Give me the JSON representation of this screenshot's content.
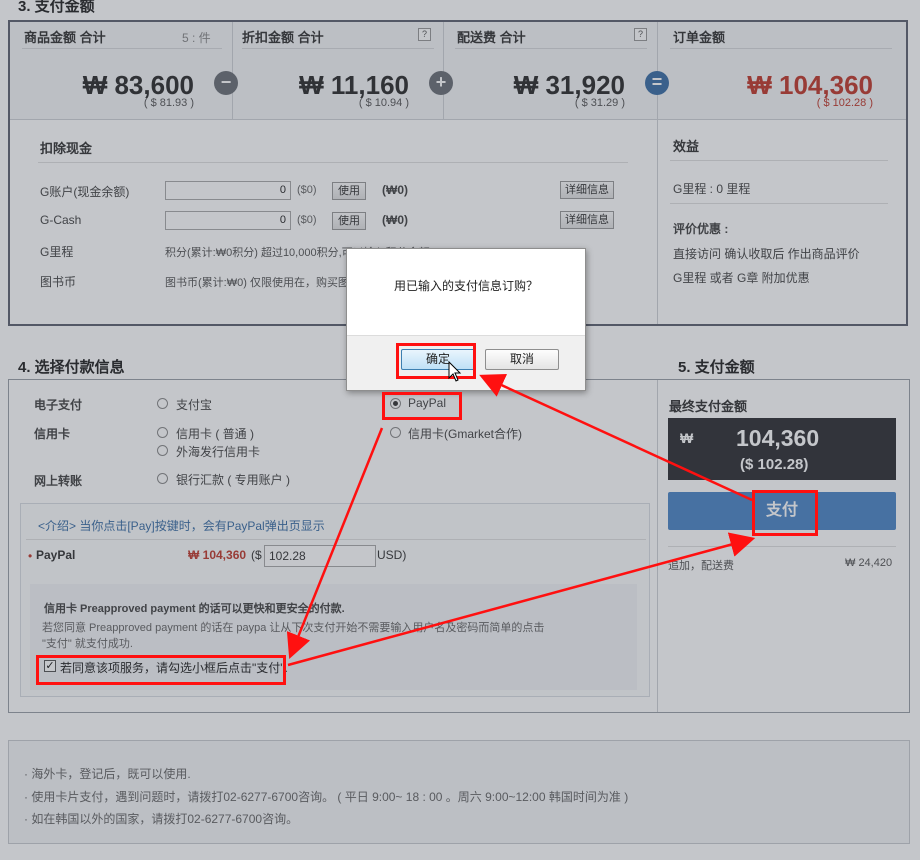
{
  "sec3": {
    "title": "3. 支付金额",
    "cols": [
      {
        "label": "商品金额 合计",
        "extra": "5 : 件",
        "amount": "₩ 83,600",
        "usd": "( $ 81.93 )"
      },
      {
        "label": "折扣金额 合计",
        "help": "?",
        "amount": "₩ 11,160",
        "usd": "( $ 10.94 )"
      },
      {
        "label": "配送费 合计",
        "help": "?",
        "amount": "₩ 31,920",
        "usd": "( $ 31.29 )"
      },
      {
        "label": "订单金额",
        "amount": "₩ 104,360",
        "usd": "( $ 102.28 )"
      }
    ],
    "ops": {
      "minus": "−",
      "plus": "+",
      "equals": "="
    },
    "deduct": {
      "title": "扣除现金",
      "rows": [
        {
          "label": "G账户(现金余额)",
          "value": "0",
          "unit": "($0)",
          "btn": "使用",
          "won": "(₩0)",
          "detail": "详细信息"
        },
        {
          "label": "G-Cash",
          "value": "0",
          "unit": "($0)",
          "btn": "使用",
          "won": "(₩0)",
          "detail": "详细信息"
        }
      ],
      "mileage_label": "G里程",
      "mileage_text": "积分(累计:₩0积分) 超过10,000积分,可以输入积分金额",
      "book_label": "图书币",
      "book_text": "图书币(累计:₩0) 仅限使用在，购买图书时"
    },
    "benefit": {
      "title": "效益",
      "mileage": "G里程 : 0 里程",
      "review_title": "评价优惠 :",
      "review_line1": "直接访问 确认收取后 作出商品评价",
      "review_line2": "G里程 或者 G章 附加优惠"
    }
  },
  "sec4": {
    "title": "4. 选择付款信息",
    "epay_label": "电子支付",
    "alipay": "支付宝",
    "paypal": "PayPal",
    "card_label": "信用卡",
    "card_normal": "信用卡 ( 普通 )",
    "card_foreign": "外海发行信用卡",
    "card_gmarket": "信用卡(Gmarket合作)",
    "bank_label": "网上转账",
    "bank_option": "银行汇款 ( 专用账户 )",
    "intro": "<介绍> 当你点击[Pay]按键时，会有PayPal弹出页显示",
    "paypal_row_label": "PayPal",
    "paypal_won": "₩ 104,360",
    "paypal_usd_prefix": "($",
    "paypal_usd_value": "102.28",
    "paypal_usd_suffix": "USD)",
    "preapproved_title": "信用卡 Preapproved payment 的话可以更快和更安全的付款.",
    "preapproved_line1": "若您同意 Preapproved payment 的话在 paypa 让从下次支付开始不需要输入用户名及密码而简单的点击",
    "preapproved_line2": "\"支付\" 就支付成功.",
    "agree_text": "若同意该项服务，请勾选小框后点击\"支付\"."
  },
  "sec5": {
    "title": "5. 支付金额",
    "final_label": "最终支付金额",
    "final_won_sign": "₩",
    "final_amount": "104,360",
    "final_usd": "($ 102.28)",
    "pay_button": "支付",
    "extra_label": "追加，配送费",
    "extra_value": "₩ 24,420"
  },
  "footer": {
    "lines": [
      "海外卡，登记后，既可以使用.",
      "使用卡片支付，遇到问题时，请拨打02-6277-6700咨询。 ( 平日 9:00~ 18 : 00 。周六 9:00~12:00 韩国时间为准 )",
      "如在韩国以外的国家，请拨打02-6277-6700咨询。"
    ]
  },
  "dialog": {
    "message": "用已输入的支付信息订购？",
    "ok": "确定",
    "cancel": "取消"
  },
  "colors": {
    "accent_red": "#c0392b",
    "pay_blue": "#4c86c6",
    "annotation_red": "#ff1010"
  }
}
